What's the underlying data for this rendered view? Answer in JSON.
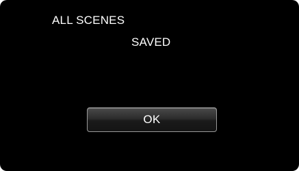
{
  "dialog": {
    "message_line_1": "ALL SCENES",
    "message_line_2": "SAVED",
    "ok_label": "OK"
  },
  "colors": {
    "background": "#000000",
    "text": "#ffffff",
    "button_border": "#9a9a9a"
  }
}
